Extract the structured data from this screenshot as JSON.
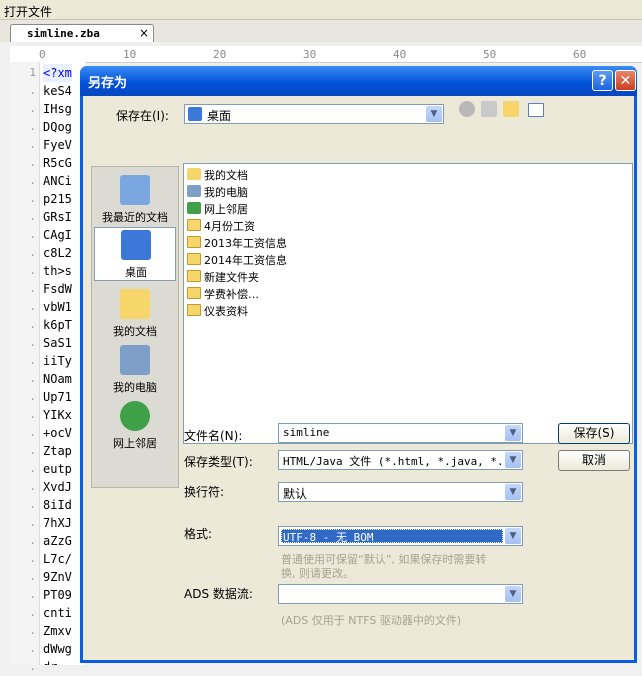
{
  "app": {
    "menu_title": "打开文件",
    "tab_name": "simline.zba",
    "tab_close": "×"
  },
  "ruler": {
    "ticks": [
      "0",
      "10",
      "20",
      "30",
      "40",
      "50",
      "60"
    ]
  },
  "editor": {
    "line_numbers": [
      "1"
    ],
    "lines": [
      "<?xm",
      "keS4",
      "IHsg",
      "DQog",
      "FyeV",
      "R5cG",
      "ANCi",
      "p215",
      "GRsI",
      "CAgI",
      "c8L2",
      "th>s",
      "FsdW",
      "vbW1",
      "k6pT",
      "SaS1",
      "iiTy",
      "NOam",
      "Up71",
      "YIKx",
      "+ocV",
      "Ztap",
      "eutp",
      "XvdJ",
      "8iId",
      "7hXJ",
      "aZzG",
      "L7c/",
      "9ZnV",
      "PT09",
      "cnti",
      "Zmxv",
      "dWwg",
      "dr"
    ]
  },
  "dialog": {
    "title": "另存为",
    "help_label": "?",
    "close_label": "✕",
    "save_in_label": "保存在(I):",
    "save_in_value": "桌面",
    "places": [
      {
        "label": "我最近的文档",
        "icon": "recent-documents-icon"
      },
      {
        "label": "桌面",
        "icon": "desktop-icon"
      },
      {
        "label": "我的文档",
        "icon": "my-documents-icon"
      },
      {
        "label": "我的电脑",
        "icon": "my-computer-icon"
      },
      {
        "label": "网上邻居",
        "icon": "network-icon"
      }
    ],
    "files": [
      {
        "name": "我的文档",
        "icon": "my-documents-icon"
      },
      {
        "name": "我的电脑",
        "icon": "my-computer-icon"
      },
      {
        "name": "网上邻居",
        "icon": "network-icon"
      },
      {
        "name": "4月份工资",
        "icon": "folder-icon"
      },
      {
        "name": "2013年工资信息",
        "icon": "folder-icon"
      },
      {
        "name": "2014年工资信息",
        "icon": "folder-icon"
      },
      {
        "name": "新建文件夹",
        "icon": "folder-icon"
      },
      {
        "name": "学费补偿…",
        "icon": "folder-icon"
      },
      {
        "name": "仪表资料",
        "icon": "folder-icon"
      }
    ],
    "filename_label": "文件名(N):",
    "filename_value": "simline",
    "filetype_label": "保存类型(T):",
    "filetype_value": "HTML/Java 文件 (*.html, *.java, *.htm",
    "newline_label": "换行符:",
    "newline_value": "默认",
    "format_label": "格式:",
    "format_value": "UTF-8 - 无 BOM",
    "format_hint_1": "普通使用可保留“默认”, 如果保存时需要转",
    "format_hint_2": "换, 则请更改。",
    "ads_label": "ADS 数据流:",
    "ads_value": "",
    "ads_hint": "(ADS 仅用于 NTFS 驱动器中的文件)",
    "save_button": "保存(S)",
    "cancel_button": "取消"
  },
  "colors": {
    "dialog_blue": "#0a5ce0",
    "selection": "#316ac5",
    "client_bg": "#ece9d8"
  }
}
